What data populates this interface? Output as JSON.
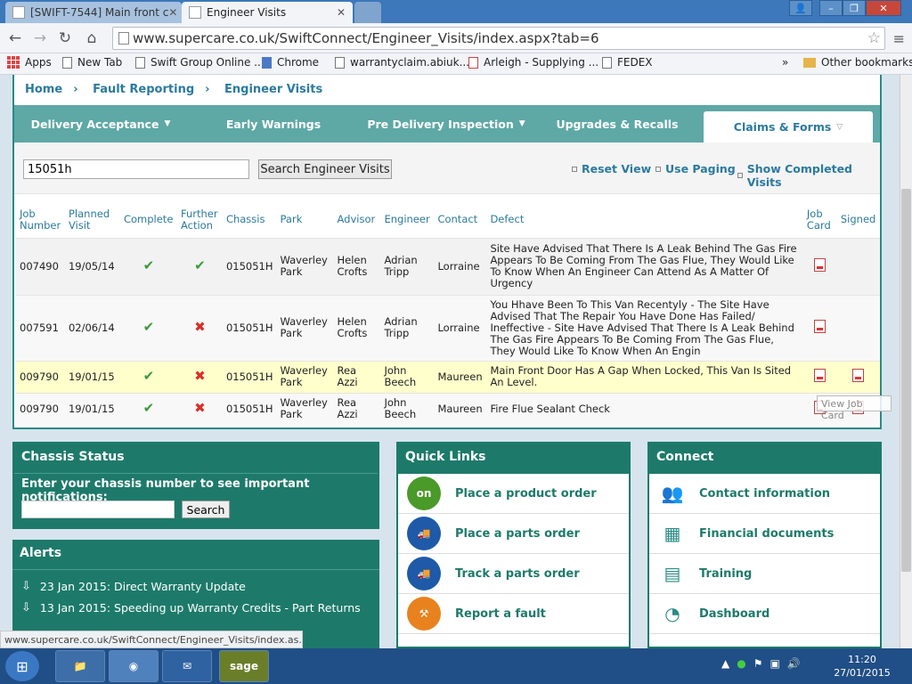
{
  "browser": {
    "tabs": [
      {
        "label": "[SWIFT-7544] Main front c"
      },
      {
        "label": "Engineer Visits"
      }
    ],
    "url": "www.supercare.co.uk/SwiftConnect/Engineer_Visits/index.aspx?tab=6",
    "bookmarks": [
      "Apps",
      "New Tab",
      "Swift Group Online ...",
      "Chrome",
      "warrantyclaim.abiuk...",
      "Arleigh - Supplying ...",
      "FEDEX"
    ],
    "bookmarks_overflow": "»",
    "other_bookmarks": "Other bookmarks",
    "status_url": "www.supercare.co.uk/SwiftConnect/Engineer_Visits/index.as..."
  },
  "breadcrumb": [
    "Home",
    "Fault Reporting",
    "Engineer Visits"
  ],
  "nav_tabs": [
    {
      "label": "Delivery Acceptance",
      "dropdown": true
    },
    {
      "label": "Early Warnings",
      "dropdown": false
    },
    {
      "label": "Pre Delivery Inspection",
      "dropdown": true
    },
    {
      "label": "Upgrades & Recalls",
      "dropdown": false
    },
    {
      "label": "Claims & Forms",
      "dropdown": true,
      "active": true
    }
  ],
  "search": {
    "value": "15051h",
    "button": "Search Engineer Visits",
    "reset_view": "Reset View",
    "use_paging": "Use Paging",
    "show_completed": "Show Completed Visits"
  },
  "table": {
    "headers": [
      "Job Number",
      "Planned Visit",
      "Complete",
      "Further Action",
      "Chassis",
      "Park",
      "Advisor",
      "Engineer",
      "Contact",
      "Defect",
      "Job Card",
      "Signed"
    ],
    "rows": [
      {
        "job": "007490",
        "planned": "19/05/14",
        "complete": true,
        "further": true,
        "chassis": "015051H",
        "park": "Waverley Park",
        "advisor": "Helen Crofts",
        "engineer": "Adrian Tripp",
        "contact": "Lorraine",
        "defect": "Site Have Advised That There Is A Leak Behind The Gas Fire Appears To Be Coming From The Gas Flue, They Would Like To Know When An Engineer Can Attend As A Matter Of Urgency",
        "job_card": true,
        "signed": false
      },
      {
        "job": "007591",
        "planned": "02/06/14",
        "complete": true,
        "further": false,
        "chassis": "015051H",
        "park": "Waverley Park",
        "advisor": "Helen Crofts",
        "engineer": "Adrian Tripp",
        "contact": "Lorraine",
        "defect": "You Hhave Been To This Van Recentyly - The Site Have Advised That The Repair You Have Done Has Failed/ Ineffective - Site Have Advised That There Is A Leak Behind The Gas Fire Appears To Be Coming From The Gas Flue, They Would Like To Know When An Engin",
        "job_card": true,
        "signed": false
      },
      {
        "job": "009790",
        "planned": "19/01/15",
        "complete": true,
        "further": false,
        "chassis": "015051H",
        "park": "Waverley Park",
        "advisor": "Rea Azzi",
        "engineer": "John Beech",
        "contact": "Maureen",
        "defect": "Main Front Door Has A Gap When Locked, This Van Is Sited An Level.",
        "job_card": true,
        "signed": true
      },
      {
        "job": "009790",
        "planned": "19/01/15",
        "complete": true,
        "further": false,
        "chassis": "015051H",
        "park": "Waverley Park",
        "advisor": "Rea Azzi",
        "engineer": "John Beech",
        "contact": "Maureen",
        "defect": "Fire Flue Sealant Check",
        "job_card": true,
        "signed": true
      }
    ],
    "tooltip": "View Job Card"
  },
  "chassis_status": {
    "title": "Chassis Status",
    "prompt": "Enter your chassis number to see important notifications:",
    "input_value": "",
    "button": "Search"
  },
  "alerts": {
    "title": "Alerts",
    "items": [
      "23 Jan 2015: Direct Warranty Update",
      "13 Jan 2015: Speeding up Warranty Credits - Part Returns"
    ]
  },
  "quick_links": {
    "title": "Quick Links",
    "items": [
      {
        "label": "Place a product order",
        "icon": "product-order-icon",
        "color": "#4a9a2a",
        "glyph": "on"
      },
      {
        "label": "Place a parts order",
        "icon": "truck-icon",
        "color": "#1e5aa8",
        "glyph": "🚚"
      },
      {
        "label": "Track a parts order",
        "icon": "truck-icon",
        "color": "#1e5aa8",
        "glyph": "🚚"
      },
      {
        "label": "Report a fault",
        "icon": "tools-icon",
        "color": "#e8821e",
        "glyph": "⚒"
      }
    ]
  },
  "connect": {
    "title": "Connect",
    "items": [
      {
        "label": "Contact information",
        "icon": "people-icon",
        "glyph": "👥"
      },
      {
        "label": "Financial documents",
        "icon": "calculator-icon",
        "glyph": "▦"
      },
      {
        "label": "Training",
        "icon": "calendar-icon",
        "glyph": "▤"
      },
      {
        "label": "Dashboard",
        "icon": "gauge-icon",
        "glyph": "◔"
      }
    ]
  },
  "taskbar": {
    "apps": [
      "",
      "",
      "",
      "sage"
    ],
    "time": "11:20",
    "date": "27/01/2015"
  },
  "colors": {
    "teal": "#1d7a6a",
    "tab_teal": "#5ea8a5",
    "link_blue": "#2b7a9f",
    "highlight_row": "#ffffcc"
  }
}
